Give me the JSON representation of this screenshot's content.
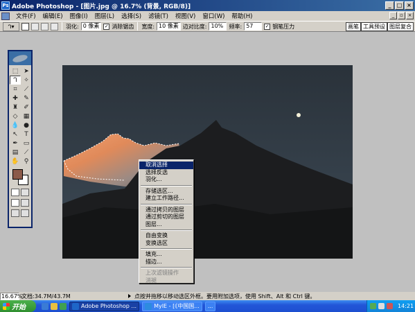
{
  "window": {
    "title": "Adobe Photoshop - [图片.jpg @ 16.7% (背景, RGB/8)]",
    "app_icon_text": "Ps"
  },
  "menubar": {
    "items": [
      "文件(F)",
      "编辑(E)",
      "图像(I)",
      "图层(L)",
      "选择(S)",
      "滤镜(T)",
      "视图(V)",
      "窗口(W)",
      "帮助(H)"
    ]
  },
  "options": {
    "feather_label": "羽化:",
    "feather_value": "0 像素",
    "antialias_label": "消除锯齿",
    "width_label": "宽度:",
    "width_value": "10 像素",
    "edge_contrast_label": "边对比度:",
    "edge_contrast_value": "10%",
    "frequency_label": "频率:",
    "frequency_value": "57",
    "pen_pressure_label": "钢笔压力",
    "palette_tabs": [
      "画笔",
      "工具预设",
      "图层复合"
    ]
  },
  "context_menu": {
    "items": [
      "取消选择",
      "选择反选",
      "羽化...",
      "存储选区...",
      "建立工作路径...",
      "通过拷贝的图层",
      "通过剪切的图层",
      "图层...",
      "自由变换",
      "变换选区",
      "填充...",
      "描边...",
      "上次滤镜操作",
      "消褪"
    ],
    "highlighted": "取消选择",
    "disabled": [
      "上次滤镜操作",
      "消褪"
    ]
  },
  "status": {
    "zoom": "16.67%",
    "doc_size": "文档:34.7M/43.7M",
    "hint": "点按并拖移以移动选区外框。要用附加选项，使用 Shift、Alt 和 Ctrl 键。"
  },
  "taskbar": {
    "start_label": "开始",
    "tasks": [
      "Adobe Photoshop ...",
      "MyIE - [《中国国...",
      "..."
    ],
    "clock": "14:21"
  },
  "colors": {
    "foreground": "#8b5a49",
    "background": "#ffffff",
    "titlebar": "#0a246a",
    "selection_highlight": "#0a246a"
  }
}
